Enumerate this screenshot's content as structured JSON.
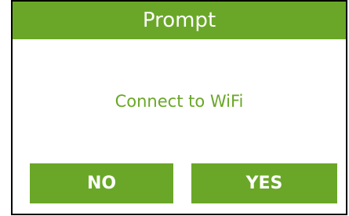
{
  "dialog": {
    "title": "Prompt",
    "message": "Connect to WiFi",
    "buttons": {
      "no_label": "NO",
      "yes_label": "YES"
    }
  },
  "colors": {
    "accent": "#6aa728",
    "border": "#000000",
    "background": "#ffffff"
  }
}
